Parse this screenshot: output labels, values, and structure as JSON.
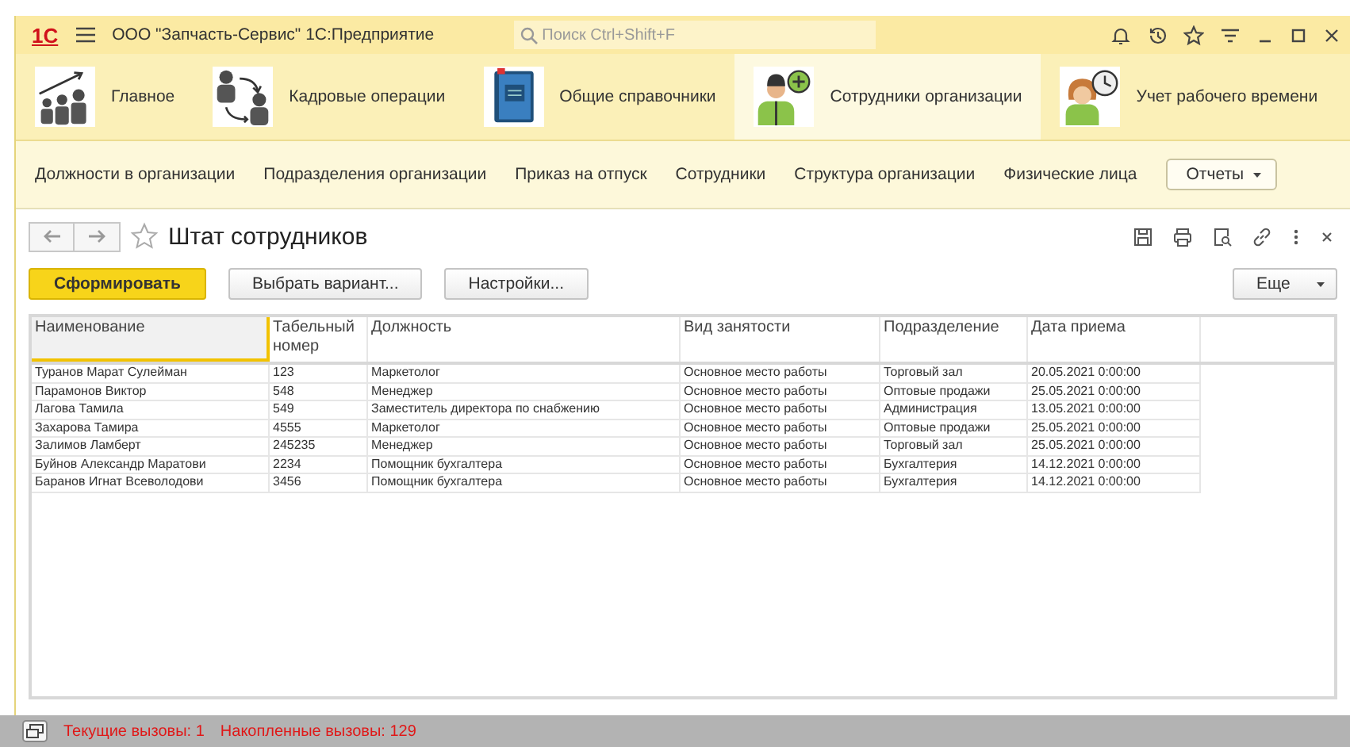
{
  "window": {
    "logo": "1С",
    "title": "ООО \"Запчасть-Сервис\" 1С:Предприятие",
    "search": {
      "placeholder": "Поиск Ctrl+Shift+F"
    }
  },
  "sections": [
    {
      "label": "Главное",
      "selected": false,
      "kind": "growth"
    },
    {
      "label": "Кадровые операции",
      "selected": false,
      "kind": "exchange"
    },
    {
      "label": "Общие справочники",
      "selected": false,
      "kind": "book"
    },
    {
      "label": "Сотрудники организации",
      "selected": true,
      "kind": "add"
    },
    {
      "label": "Учет рабочего времени",
      "selected": false,
      "kind": "clock"
    }
  ],
  "links": [
    "Должности в организации",
    "Подразделения организации",
    "Приказ на отпуск",
    "Сотрудники",
    "Структура организации",
    "Физические лица"
  ],
  "reports_button": "Отчеты",
  "form": {
    "title": "Штат сотрудников",
    "buttons": [
      {
        "label": "Сформировать",
        "kind": "primary"
      },
      {
        "label": "Выбрать вариант...",
        "kind": "normal"
      },
      {
        "label": "Настройки...",
        "kind": "normal"
      }
    ],
    "more_button": "Еще"
  },
  "table": {
    "columns": [
      {
        "label": "Наименование",
        "selected": true
      },
      {
        "label": "Табельный номер",
        "selected": false
      },
      {
        "label": "Должность",
        "selected": false
      },
      {
        "label": "Вид занятости",
        "selected": false
      },
      {
        "label": "Подразделение",
        "selected": false
      },
      {
        "label": "Дата приема",
        "selected": false
      }
    ],
    "rows": [
      [
        "Туранов Марат Сулейман",
        "123",
        "Маркетолог",
        "Основное место работы",
        "Торговый зал",
        "20.05.2021 0:00:00"
      ],
      [
        "Парамонов Виктор",
        "548",
        "Менеджер",
        "Основное место работы",
        "Оптовые продажи",
        "25.05.2021 0:00:00"
      ],
      [
        "Лагова Тамила",
        "549",
        "Заместитель директора по снабжению",
        "Основное место работы",
        "Администрация",
        "13.05.2021 0:00:00"
      ],
      [
        "Захарова Тамира",
        "4555",
        "Маркетолог",
        "Основное место работы",
        "Оптовые продажи",
        "25.05.2021 0:00:00"
      ],
      [
        "Залимов Ламберт",
        "245235",
        "Менеджер",
        "Основное место работы",
        "Торговый зал",
        "25.05.2021 0:00:00"
      ],
      [
        "Буйнов Александр Маратови",
        "2234",
        "Помощник бухгалтера",
        "Основное место работы",
        "Бухгалтерия",
        "14.12.2021 0:00:00"
      ],
      [
        "Баранов Игнат Всеволодови",
        "3456",
        "Помощник бухгалтера",
        "Основное место работы",
        "Бухгалтерия",
        "14.12.2021 0:00:00"
      ]
    ]
  },
  "status_bar": {
    "current_calls": "Текущие вызовы: 1",
    "accumulated_calls": "Накопленные вызовы: 129"
  }
}
